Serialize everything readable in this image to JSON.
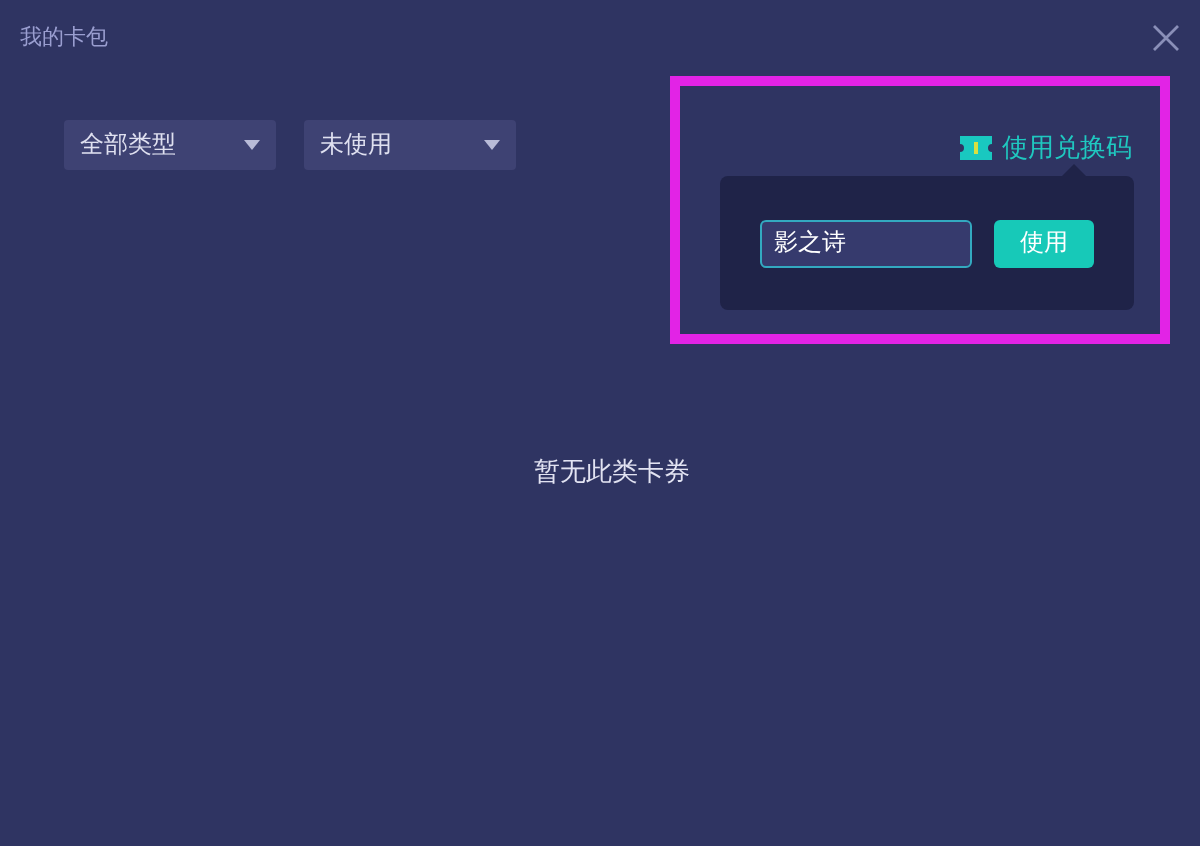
{
  "window": {
    "title": "我的卡包"
  },
  "filters": [
    {
      "label": "全部类型"
    },
    {
      "label": "未使用"
    }
  ],
  "redeem_link": {
    "label": "使用兑换码"
  },
  "redeem_popover": {
    "input": {
      "value": "影之诗"
    },
    "button": "使用"
  },
  "empty_message": "暂无此类卡券"
}
